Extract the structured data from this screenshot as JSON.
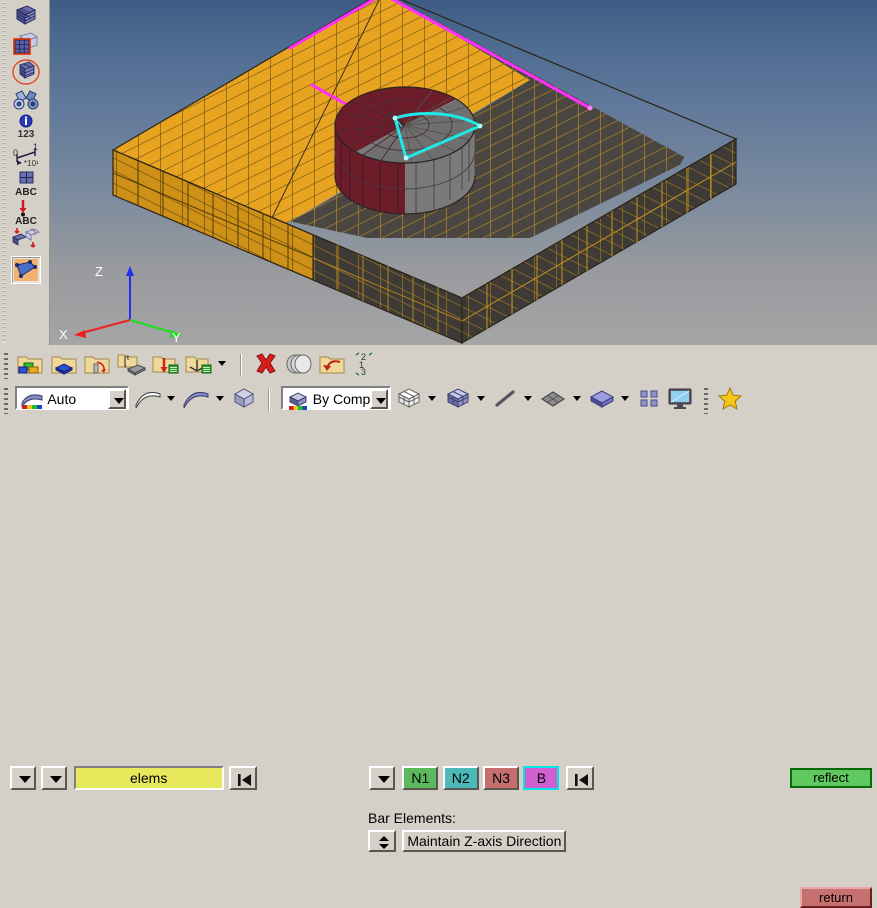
{
  "side_toolbar": {
    "items": [
      {
        "name": "mesh-surface-icon",
        "label": "Mesh Surface"
      },
      {
        "name": "mesh-edit-icon",
        "label": "Mesh Edit"
      },
      {
        "name": "mesh-circle-icon",
        "label": "Mesh Between"
      },
      {
        "name": "binoculars-icon",
        "label": "Find"
      },
      {
        "name": "info-123-icon",
        "label": "Info 123"
      },
      {
        "name": "measure-ruler-icon",
        "label": "Measure"
      },
      {
        "name": "mesh-abc-icon",
        "label": "Mesh Label"
      },
      {
        "name": "node-abc-icon",
        "label": "Node Label"
      },
      {
        "name": "reflect-mesh-icon",
        "label": "Reflect Mesh"
      },
      {
        "name": "element-select-icon",
        "label": "Element"
      }
    ],
    "selected_index": 9
  },
  "viewport": {
    "axis_triad": {
      "x_label": "X",
      "y_label": "Y",
      "z_label": "Z",
      "x_color": "#ee2020",
      "y_color": "#20dd20",
      "z_color": "#2030ee"
    },
    "colors": {
      "plate_front": "#e8a321",
      "plate_back": "#4a4742",
      "boss_front": "#7c1f2c",
      "boss_back": "#7a7a7a",
      "highlight_edge": "#ff30ff",
      "selection_edge": "#20e8e8",
      "mesh_dark": "#5a4408",
      "mesh_gold": "#c8921c",
      "bg_top": "#3d5b84",
      "bg_bottom": "#a5a5a6"
    }
  },
  "toolbar_icons_row1": [
    {
      "name": "folder-blocks-icon"
    },
    {
      "name": "folder-solid-icon"
    },
    {
      "name": "folder-constraint-icon"
    },
    {
      "name": "thickness-plate-icon"
    },
    {
      "name": "load-arrow-icon"
    },
    {
      "name": "axes-list-icon"
    },
    {
      "name": "delete-x-icon"
    },
    {
      "name": "layers-icon"
    },
    {
      "name": "folder-import-icon"
    },
    {
      "name": "renumber-123-icon"
    }
  ],
  "toolbar_icons_row2": [
    {
      "name": "surface-plain-icon"
    },
    {
      "name": "surface-shaded-icon"
    },
    {
      "name": "cube-plain-icon"
    },
    {
      "name": "cube-white-icon"
    },
    {
      "name": "cube-blue-icon"
    },
    {
      "name": "line-element-icon"
    },
    {
      "name": "mesh-plate-icon"
    },
    {
      "name": "solid-plate-icon"
    },
    {
      "name": "group-dots-icon"
    },
    {
      "name": "monitor-icon"
    },
    {
      "name": "star-favorite-icon"
    }
  ],
  "view_combo": {
    "value": "Auto",
    "icon_name": "shaded-surface-icon"
  },
  "color_combo": {
    "value": "By Comp",
    "icon_name": "cube-color-icon"
  },
  "selection": {
    "entity_value": "elems",
    "prev_arrow_name": "dropdown-arrow-1",
    "next_arrow_name": "dropdown-arrow-2",
    "reset_name": "rewind-to-start"
  },
  "node_buttons": {
    "dropdown_name": "node-dropdown",
    "items": [
      {
        "label": "N1",
        "color": "#5cb85c"
      },
      {
        "label": "N2",
        "color": "#4cb8b8"
      },
      {
        "label": "N3",
        "color": "#c56e6e"
      },
      {
        "label": "B",
        "color": "#d060d0"
      }
    ],
    "highlighted_index": 3,
    "reset_name": "rewind-to-start"
  },
  "reflect": {
    "label": "reflect"
  },
  "bar_elements": {
    "label": "Bar Elements:",
    "value": "Maintain Z-axis Direction",
    "spinner_name": "bar-elements-spinner"
  },
  "return": {
    "label": "return"
  }
}
